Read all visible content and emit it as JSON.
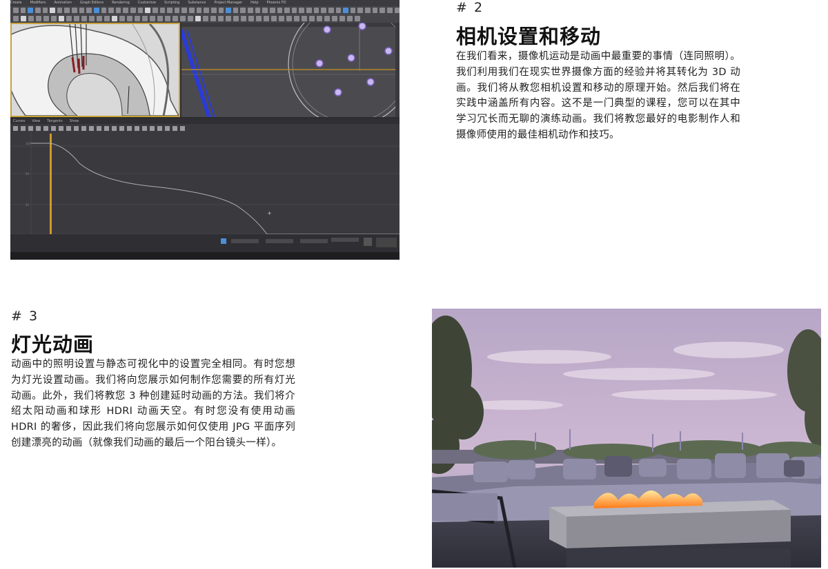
{
  "section2": {
    "number": "# 2",
    "title": "相机设置和移动",
    "body": "在我们看来，摄像机运动是动画中最重要的事情（连同照明）。我们利用我们在现实世界摄像方面的经验并将其转化为 3D 动画。我们将从教您相机设置和移动的原理开始。然后我们将在实践中涵盖所有内容。这不是一门典型的课程，您可以在其中学习冗长而无聊的演练动画。我们将教您最好的电影制作人和摄像师使用的最佳相机动作和技巧。"
  },
  "section3": {
    "number": "# 3",
    "title": "灯光动画",
    "body": "动画中的照明设置与静态可视化中的设置完全相同。有时您想为灯光设置动画。我们将向您展示如何制作您需要的所有灯光动画。此外，我们将教您 3 种创建延时动画的方法。我们将介绍太阳动画和球形 HDRI 动画天空。有时您没有使用动画 HDRI 的奢侈，因此我们将向您展示如何仅使用 JPG 平面序列创建漂亮的动画（就像我们动画的最后一个阳台镜头一样）。"
  },
  "screenshot": {
    "menu_items": [
      "Create",
      "Modifiers",
      "Animation",
      "Graph Editors",
      "Rendering",
      "Customize",
      "Scripting",
      "Substance",
      "Project Manager",
      "Help",
      "Phoenix FD"
    ],
    "curve_menu_items": [
      "Curves",
      "View",
      "Tangents",
      "Show"
    ],
    "accent_color": "#c8a23a",
    "timeline_color": "#d09a2a"
  },
  "photo": {
    "subject": "rooftop-terrace-fire-pit"
  }
}
